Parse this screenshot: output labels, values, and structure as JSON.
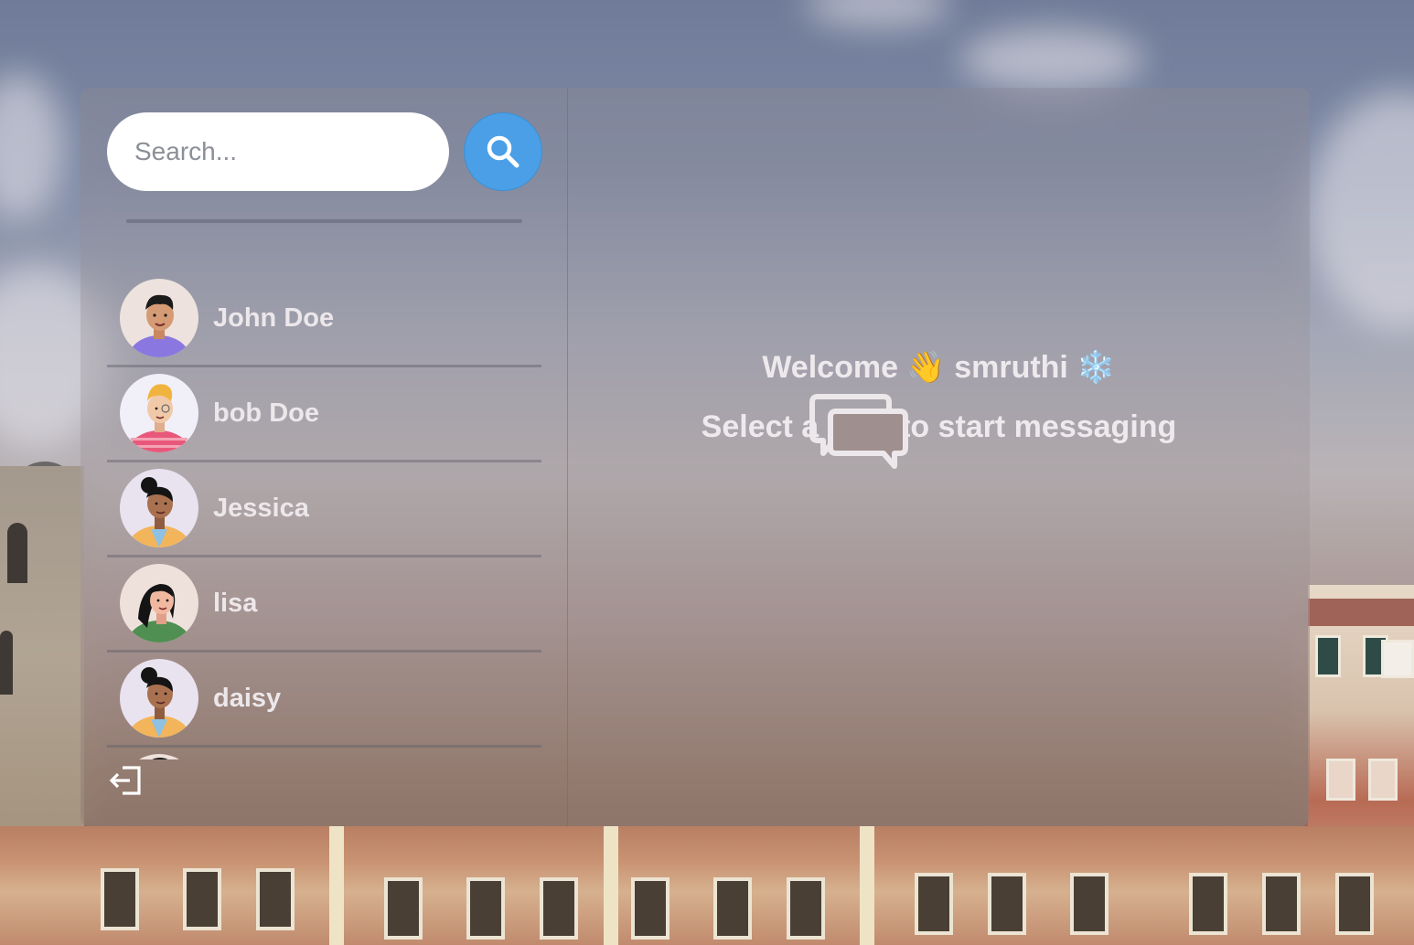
{
  "search": {
    "placeholder": "Search...",
    "button_icon": "search-icon"
  },
  "conversations": [
    {
      "name": "John Doe",
      "avatar_colors": {
        "bg": "#ede2dd",
        "shirt": "#8a78e0",
        "skin": "#d59b74",
        "hair": "#1b1b1b"
      }
    },
    {
      "name": "bob Doe",
      "avatar_colors": {
        "bg": "#f1eff8",
        "shirt": "#e8587a",
        "skin": "#f0c9a9",
        "hair": "#f0b43e"
      }
    },
    {
      "name": "Jessica",
      "avatar_colors": {
        "bg": "#e9e3ef",
        "shirt": "#f2b55c",
        "skin": "#a9714f",
        "hair": "#141414"
      }
    },
    {
      "name": "lisa",
      "avatar_colors": {
        "bg": "#eee1dc",
        "shirt": "#4f8f52",
        "skin": "#f0b8a0",
        "hair": "#141414"
      }
    },
    {
      "name": "daisy",
      "avatar_colors": {
        "bg": "#e9e3ef",
        "shirt": "#f2b55c",
        "skin": "#a9714f",
        "hair": "#141414"
      }
    }
  ],
  "logout_icon": "logout-icon",
  "main": {
    "welcome": "Welcome 👋 smruthi ❄️",
    "subtitle": "Select a chat to start messaging",
    "empty_icon": "chat-bubbles-icon"
  },
  "colors": {
    "accent": "#4a9fe6",
    "text": "#eee9ec"
  }
}
